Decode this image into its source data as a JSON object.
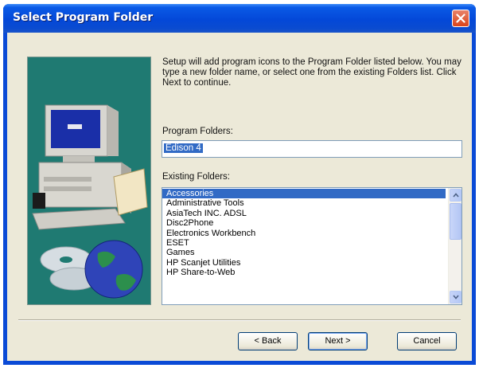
{
  "window": {
    "title": "Select Program Folder"
  },
  "intro_text": "Setup will add program icons to the Program Folder listed below. You may type a new folder name, or select one from the existing Folders list. Click Next to continue.",
  "program_folder": {
    "label": "Program Folders:",
    "value": "Edison 4"
  },
  "existing_folders": {
    "label": "Existing Folders:",
    "items": [
      "Accessories",
      "Administrative Tools",
      "AsiaTech INC. ADSL",
      "Disc2Phone",
      "Electronics Workbench",
      "ESET",
      "Games",
      "HP Scanjet Utilities",
      "HP Share-to-Web"
    ],
    "selected_index": 0
  },
  "buttons": {
    "back": "< Back",
    "next": "Next >",
    "cancel": "Cancel"
  },
  "colors": {
    "title_bar": "#0a4ad6",
    "dialog_face": "#ece9d8",
    "selection": "#316ac5",
    "art_panel": "#1f7a72",
    "close_button": "#d9441b"
  }
}
